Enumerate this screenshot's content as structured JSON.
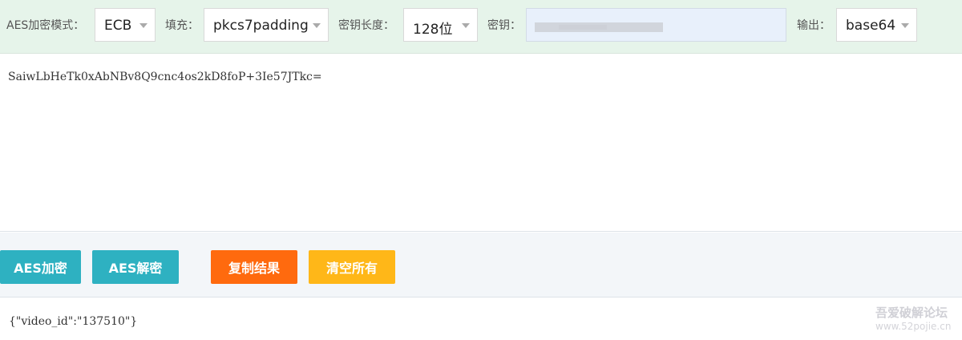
{
  "toolbar": {
    "mode_label": "AES加密模式：",
    "mode_value": "ECB",
    "padding_label": "填充：",
    "padding_value": "pkcs7padding",
    "keylen_label": "密钥长度：",
    "keylen_value": "128位",
    "key_label": "密钥：",
    "output_label": "输出：",
    "output_value": "base64"
  },
  "output": {
    "text": "SaiwLbHeTk0xAbNBv8Q9cnc4os2kD8foP+3Ie57JTkc="
  },
  "buttons": {
    "encrypt": "AES加密",
    "decrypt": "AES解密",
    "copy": "复制结果",
    "clear": "清空所有"
  },
  "input": {
    "text": "{\"video_id\":\"137510\"}"
  },
  "watermark": {
    "line1": "吾爱破解论坛",
    "line2": "www.52pojie.cn"
  },
  "colors": {
    "toolbar_bg": "#e6f4ea",
    "encrypt": "#2eb1c1",
    "decrypt": "#2eb1c1",
    "copy": "#ff6a0e",
    "clear": "#ffb718"
  }
}
